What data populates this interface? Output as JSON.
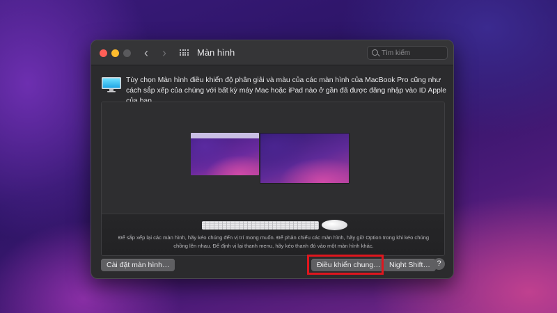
{
  "window": {
    "title": "Màn hình",
    "search_placeholder": "Tìm kiếm"
  },
  "description": "Tùy chọn Màn hình điều khiển độ phân giải và màu của các màn hình của MacBook Pro cũng như cách sắp xếp của chúng với bất kỳ máy Mac hoặc iPad nào ở gần đã được đăng nhập vào ID Apple của bạn.",
  "arrangement": {
    "help_text": "Để sắp xếp lại các màn hình, hãy kéo chúng đến vị trí mong muốn. Để phản chiếu các màn hình, hãy giữ Option trong khi kéo chúng chồng lên nhau. Để định vị lại thanh menu, hãy kéo thanh đó vào một màn hình khác."
  },
  "buttons": {
    "display_settings": "Cài đặt màn hình…",
    "general_control": "Điều khiển chung…",
    "night_shift": "Night Shift…",
    "help": "?"
  },
  "colors": {
    "highlight": "#e0161e",
    "close": "#ff5f57",
    "minimize": "#febc2e"
  }
}
